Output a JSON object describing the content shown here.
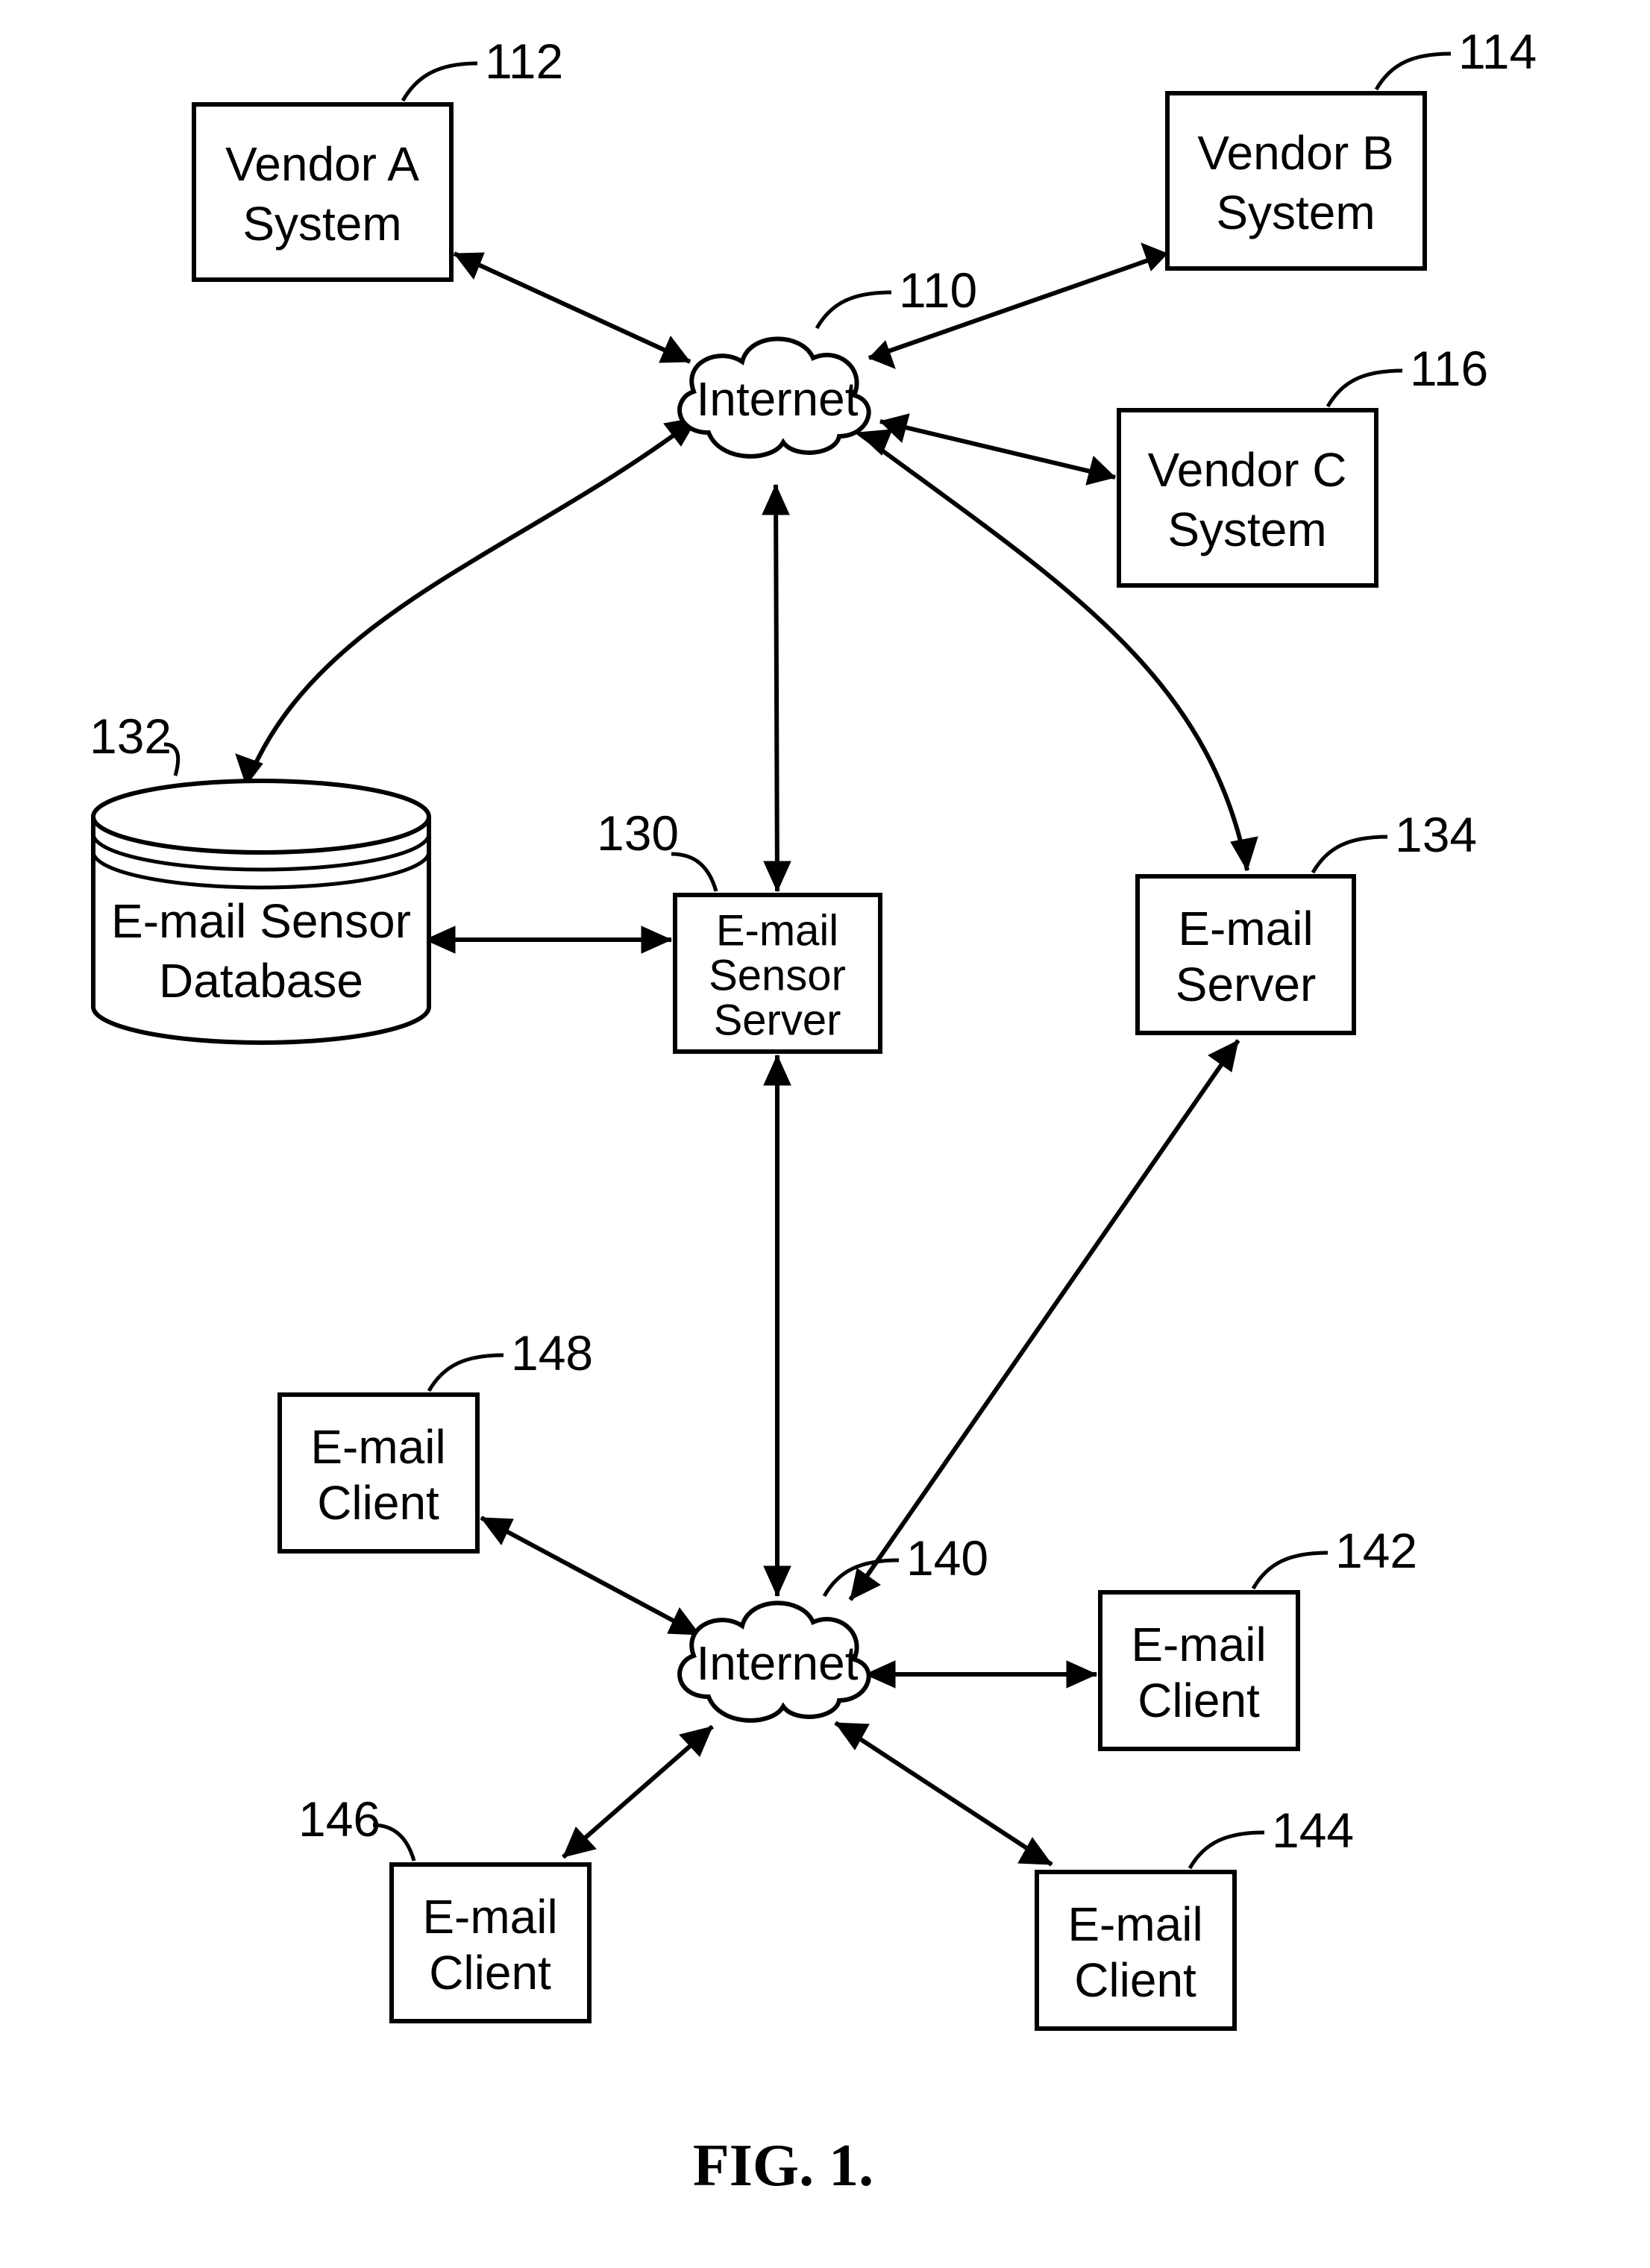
{
  "figure_label": "FIG. 1.",
  "nodes": {
    "vendor_a": {
      "ref": "112",
      "line1": "Vendor A",
      "line2": "System"
    },
    "vendor_b": {
      "ref": "114",
      "line1": "Vendor B",
      "line2": "System"
    },
    "vendor_c": {
      "ref": "116",
      "line1": "Vendor C",
      "line2": "System"
    },
    "internet_top": {
      "ref": "110",
      "label": "Internet"
    },
    "email_sensor_db": {
      "ref": "132",
      "line1": "E-mail Sensor",
      "line2": "Database"
    },
    "email_sensor_server": {
      "ref": "130",
      "line1": "E-mail",
      "line2": "Sensor",
      "line3": "Server"
    },
    "email_server": {
      "ref": "134",
      "line1": "E-mail",
      "line2": "Server"
    },
    "internet_bottom": {
      "ref": "140",
      "label": "Internet"
    },
    "client1": {
      "ref": "148",
      "line1": "E-mail",
      "line2": "Client"
    },
    "client2": {
      "ref": "142",
      "line1": "E-mail",
      "line2": "Client"
    },
    "client3": {
      "ref": "146",
      "line1": "E-mail",
      "line2": "Client"
    },
    "client4": {
      "ref": "144",
      "line1": "E-mail",
      "line2": "Client"
    }
  }
}
